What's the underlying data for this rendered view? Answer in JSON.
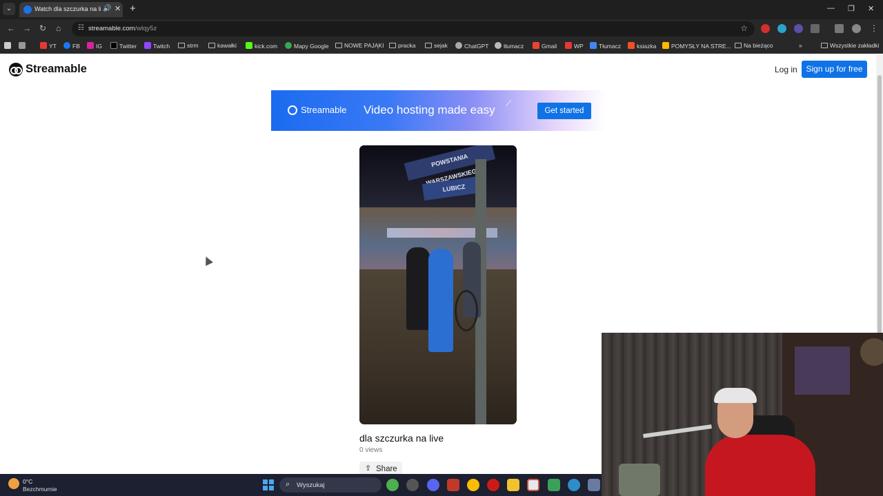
{
  "browser": {
    "tab_title": "Watch dla szczurka na live |",
    "url_host": "streamable.com",
    "url_path": "/wlqy5z",
    "bookmarks": [
      "YT",
      "FB",
      "IG",
      "Twitter",
      "Twitch",
      "strm",
      "kawałki",
      "kick.com",
      "Mapy Google",
      "NOWE PAJĄKI",
      "pracka",
      "sejak",
      "ChatGPT",
      "tłumacz",
      "Gmail",
      "WP",
      "Tłumacz",
      "ksiazka",
      "POMYSŁY NA STRE...",
      "Na bieżąco"
    ],
    "all_bookmarks": "Wszystkie zakładki"
  },
  "site": {
    "brand": "Streamable",
    "login": "Log in",
    "signup": "Sign up for free"
  },
  "banner": {
    "brand": "Streamable",
    "tagline": "Video hosting made easy",
    "cta": "Get started",
    "colors": {
      "start": "#1b6bf0",
      "end": "#ffffff"
    }
  },
  "video": {
    "sign_top": "POWSTANIA WARSZAWSKIEGO",
    "sign_bottom": "LUBICZ",
    "title": "dla szczurka na live",
    "views": "0 views",
    "share": "Share"
  },
  "taskbar": {
    "temperature": "0°C",
    "condition": "Bezchmurnie",
    "search_placeholder": "Wyszukaj"
  },
  "colors": {
    "accent": "#0f72e6"
  }
}
